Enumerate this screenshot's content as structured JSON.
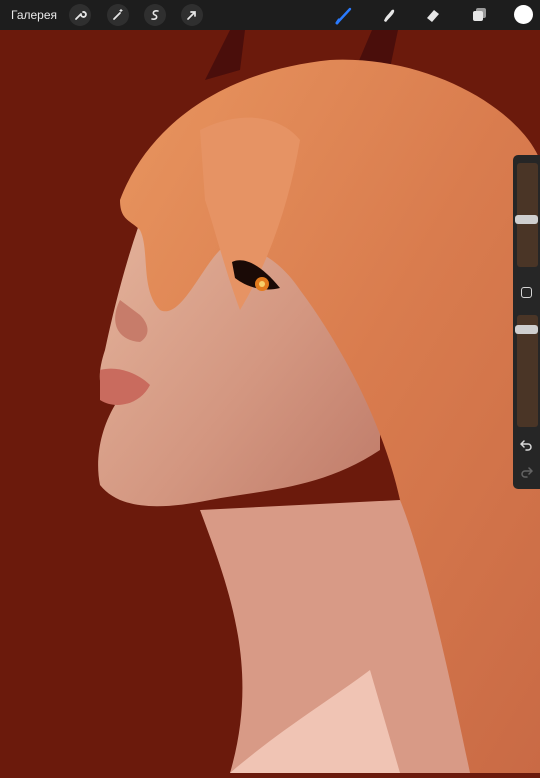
{
  "toolbar": {
    "gallery_label": "Галерея",
    "left_tools": [
      "wrench-icon",
      "magic-wand-icon",
      "selection-icon",
      "transform-icon"
    ],
    "right_tools": [
      "brush-icon",
      "smudge-icon",
      "eraser-icon",
      "layers-icon"
    ],
    "active_tool": "brush-icon",
    "accent_color": "#2a7bff",
    "current_color": "#ffffff"
  },
  "sidebar": {
    "brush_size_level": 0.35,
    "opacity_level": 0.6,
    "undo_icon": "undo-icon",
    "redo_icon": "redo-icon"
  },
  "canvas": {
    "background_color": "#6b1a0c"
  }
}
